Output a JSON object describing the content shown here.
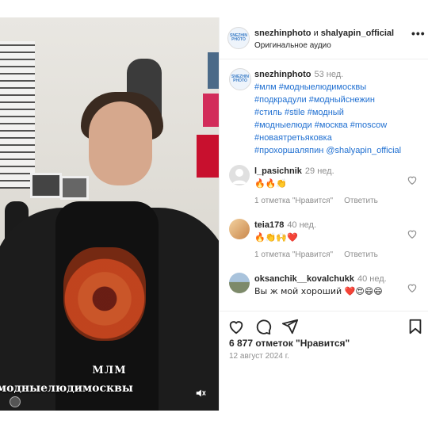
{
  "post": {
    "media": {
      "overlay_line1": "МЛМ",
      "overlay_line2": "модныелюдимосквы"
    },
    "header": {
      "author1": "snezhinphoto",
      "joiner": "и",
      "author2": "shalyapin_official",
      "audio": "Оригинальное аудио",
      "more_icon": "more-horizontal-icon",
      "brand_text": "SNEZHIN PHOTO"
    },
    "caption": {
      "user": "snezhinphoto",
      "time": "53 нед.",
      "lines": [
        "#млм #модныелюдимосквы",
        "#подкрадули #модныйснежин",
        "#стиль #stile #модный",
        "#модныелюди #москва #moscow",
        "#новаятретьяковка",
        "#прохоршаляпин @shalyapin_official"
      ]
    },
    "comments": [
      {
        "user": "l_pasichnik",
        "time": "29 нед.",
        "text": "🔥🔥👏",
        "likes": "1 отметка \"Нравится\"",
        "reply": "Ответить"
      },
      {
        "user": "teia178",
        "time": "40 нед.",
        "text": "🔥👏🙌❤️",
        "likes": "1 отметка \"Нравится\"",
        "reply": "Ответить"
      },
      {
        "user": "oksanchik__kovalchukk",
        "time": "40 нед.",
        "text": "Вы ж мой хороший ❤️😍😄😄",
        "likes": "",
        "reply": ""
      }
    ],
    "actions": {
      "like_icon": "heart-icon",
      "comment_icon": "comment-icon",
      "share_icon": "send-icon",
      "save_icon": "bookmark-icon"
    },
    "likes_text": "6 877 отметок \"Нравится\"",
    "date": "12 август 2024 г.",
    "colors": {
      "link": "#1f6fd1",
      "muted": "#8e8e8e",
      "text": "#262626",
      "heart_red": "#ed4956"
    }
  }
}
